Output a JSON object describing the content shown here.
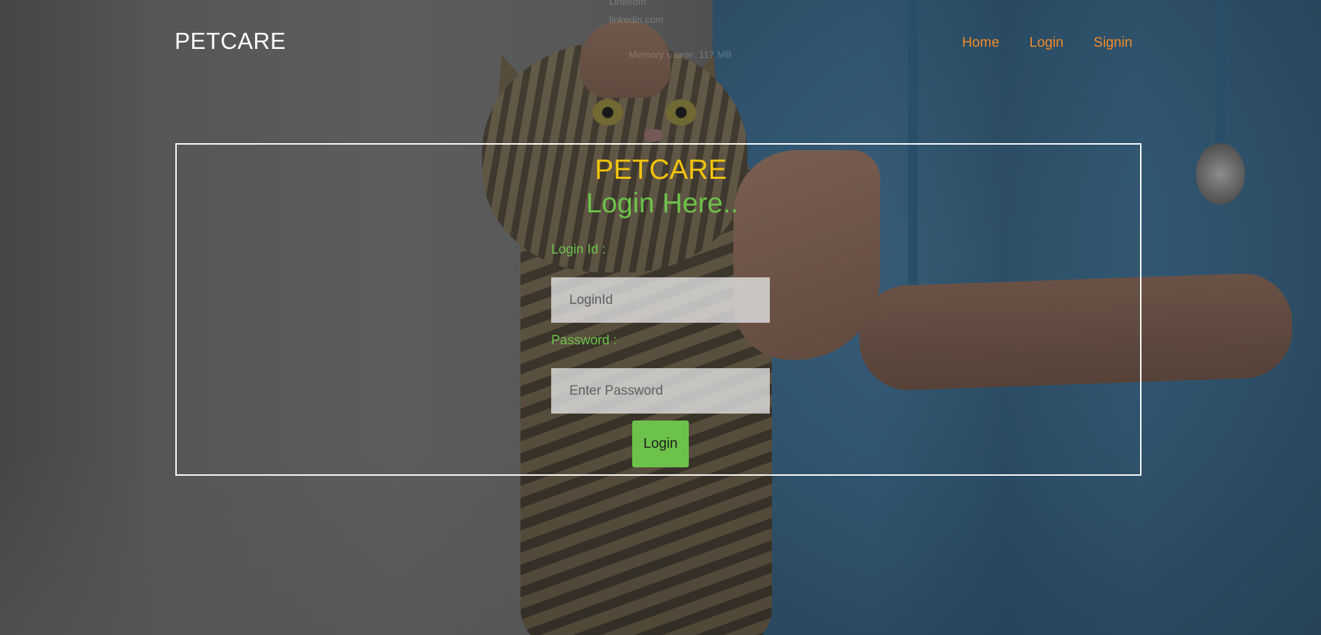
{
  "header": {
    "brand": "PETCARE",
    "nav": [
      "Home",
      "Login",
      "Signin"
    ]
  },
  "login_form": {
    "brand": "PETCARE",
    "title": "Login Here..",
    "login_id_label": "Login Id :",
    "login_id_placeholder": "LoginId",
    "password_label": "Password :",
    "password_placeholder": "Enter Password",
    "submit_label": "Login"
  },
  "ghost_overlay": {
    "line1": "LinkedIn",
    "line2": "linkedin.com",
    "line3": "Memory usage: 117 MB"
  },
  "colors": {
    "brand_yellow": "#f2c40c",
    "accent_green": "#6cc24a",
    "nav_orange": "#f08a2a"
  }
}
